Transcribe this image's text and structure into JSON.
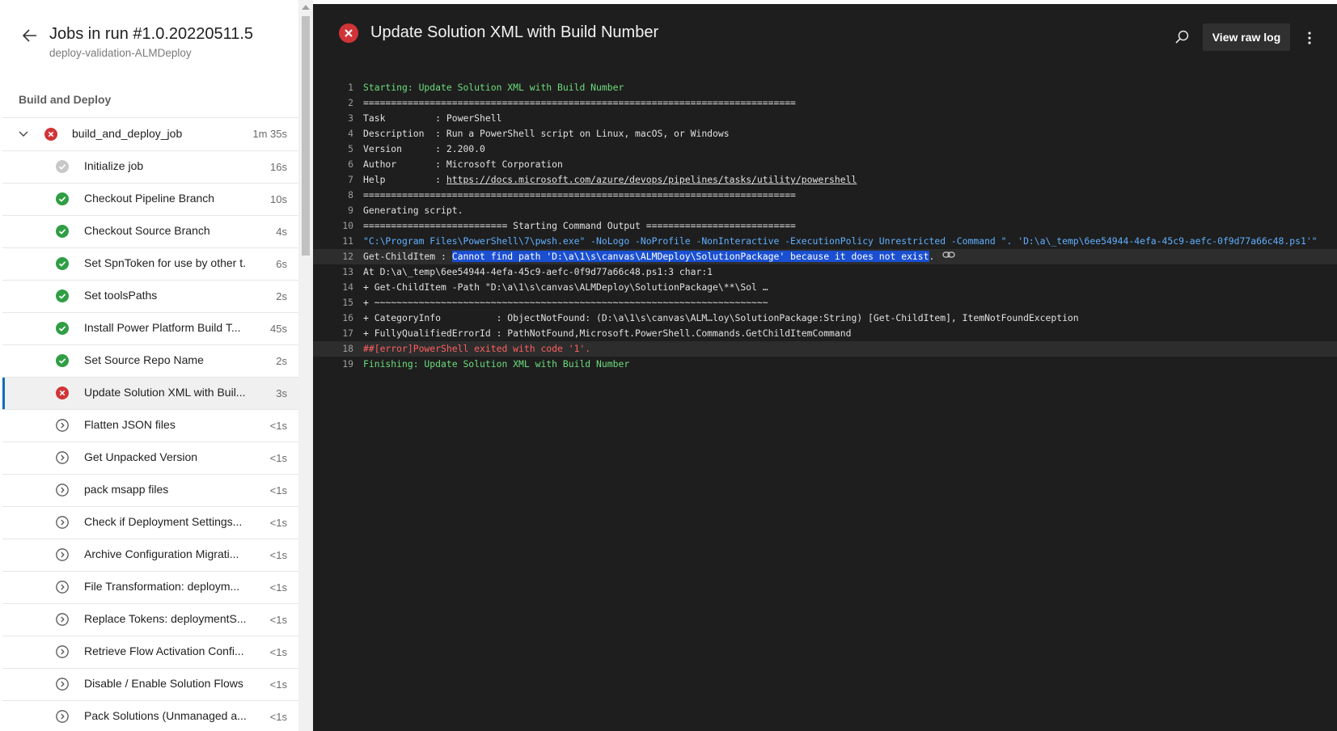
{
  "header": {
    "run_title": "Jobs in run #1.0.20220511.5",
    "run_subtitle": "deploy-validation-ALMDeploy",
    "stage_title": "Build and Deploy"
  },
  "job": {
    "name": "build_and_deploy_job",
    "duration": "1m 35s",
    "status": "failed"
  },
  "steps": [
    {
      "name": "Initialize job",
      "duration": "16s",
      "status": "skipped"
    },
    {
      "name": "Checkout Pipeline Branch",
      "duration": "10s",
      "status": "succeeded"
    },
    {
      "name": "Checkout Source Branch",
      "duration": "4s",
      "status": "succeeded"
    },
    {
      "name": "Set SpnToken for use by other t...",
      "duration": "6s",
      "status": "succeeded"
    },
    {
      "name": "Set toolsPaths",
      "duration": "2s",
      "status": "succeeded"
    },
    {
      "name": "Install Power Platform Build T...",
      "duration": "45s",
      "status": "succeeded"
    },
    {
      "name": "Set Source Repo Name",
      "duration": "2s",
      "status": "succeeded"
    },
    {
      "name": "Update Solution XML with Buil...",
      "duration": "3s",
      "status": "failed",
      "selected": true
    },
    {
      "name": "Flatten JSON files",
      "duration": "<1s",
      "status": "pending"
    },
    {
      "name": "Get Unpacked Version",
      "duration": "<1s",
      "status": "pending"
    },
    {
      "name": "pack msapp files",
      "duration": "<1s",
      "status": "pending"
    },
    {
      "name": "Check if Deployment Settings...",
      "duration": "<1s",
      "status": "pending"
    },
    {
      "name": "Archive Configuration Migrati...",
      "duration": "<1s",
      "status": "pending"
    },
    {
      "name": "File Transformation: deploym...",
      "duration": "<1s",
      "status": "pending"
    },
    {
      "name": "Replace Tokens: deploymentS...",
      "duration": "<1s",
      "status": "pending"
    },
    {
      "name": "Retrieve Flow Activation Confi...",
      "duration": "<1s",
      "status": "pending"
    },
    {
      "name": "Disable / Enable Solution Flows",
      "duration": "<1s",
      "status": "pending"
    },
    {
      "name": "Pack Solutions (Unmanaged a...",
      "duration": "<1s",
      "status": "pending"
    }
  ],
  "log_panel": {
    "title": "Update Solution XML with Build Number",
    "raw_log_label": "View raw log"
  },
  "log_lines": [
    {
      "n": "1",
      "style": "green",
      "parts": [
        {
          "t": "Starting: Update Solution XML with Build Number"
        }
      ]
    },
    {
      "n": "2",
      "parts": [
        {
          "t": "=============================================================================="
        }
      ]
    },
    {
      "n": "3",
      "parts": [
        {
          "t": "Task         : PowerShell"
        }
      ]
    },
    {
      "n": "4",
      "parts": [
        {
          "t": "Description  : Run a PowerShell script on Linux, macOS, or Windows"
        }
      ]
    },
    {
      "n": "5",
      "parts": [
        {
          "t": "Version      : 2.200.0"
        }
      ]
    },
    {
      "n": "6",
      "parts": [
        {
          "t": "Author       : Microsoft Corporation"
        }
      ]
    },
    {
      "n": "7",
      "parts": [
        {
          "t": "Help         : "
        },
        {
          "t": "https://docs.microsoft.com/azure/devops/pipelines/tasks/utility/powershell",
          "link": true
        }
      ]
    },
    {
      "n": "8",
      "parts": [
        {
          "t": "=============================================================================="
        }
      ]
    },
    {
      "n": "9",
      "parts": [
        {
          "t": "Generating script."
        }
      ]
    },
    {
      "n": "10",
      "parts": [
        {
          "t": "========================== Starting Command Output ==========================="
        }
      ]
    },
    {
      "n": "11",
      "style": "blue",
      "parts": [
        {
          "t": "\"C:\\Program Files\\PowerShell\\7\\pwsh.exe\" -NoLogo -NoProfile -NonInteractive -ExecutionPolicy Unrestricted -Command \". 'D:\\a\\_temp\\6ee54944-4efa-45c9-aefc-0f9d77a66c48.ps1'\""
        }
      ]
    },
    {
      "n": "12",
      "highlight": true,
      "copy": true,
      "parts": [
        {
          "t": "Get-ChildItem : "
        },
        {
          "t": "Cannot find path 'D:\\a\\1\\s\\canvas\\ALMDeploy\\SolutionPackage' because it does not exist",
          "sel": true
        },
        {
          "t": "."
        }
      ]
    },
    {
      "n": "13",
      "parts": [
        {
          "t": "At D:\\a\\_temp\\6ee54944-4efa-45c9-aefc-0f9d77a66c48.ps1:3 char:1"
        }
      ]
    },
    {
      "n": "14",
      "parts": [
        {
          "t": "+ Get-ChildItem -Path \"D:\\a\\1\\s\\canvas\\ALMDeploy\\SolutionPackage\\**\\Sol …"
        }
      ]
    },
    {
      "n": "15",
      "parts": [
        {
          "t": "+ ~~~~~~~~~~~~~~~~~~~~~~~~~~~~~~~~~~~~~~~~~~~~~~~~~~~~~~~~~~~~~~~~~~~~~~~"
        }
      ]
    },
    {
      "n": "16",
      "parts": [
        {
          "t": "+ CategoryInfo          : ObjectNotFound: (D:\\a\\1\\s\\canvas\\ALM…loy\\SolutionPackage:String) [Get-ChildItem], ItemNotFoundException"
        }
      ]
    },
    {
      "n": "17",
      "parts": [
        {
          "t": "+ FullyQualifiedErrorId : PathNotFound,Microsoft.PowerShell.Commands.GetChildItemCommand"
        }
      ]
    },
    {
      "n": "18",
      "style": "red",
      "highlight": true,
      "parts": [
        {
          "t": "##[error]PowerShell exited with code '1'."
        }
      ]
    },
    {
      "n": "19",
      "style": "green",
      "parts": [
        {
          "t": "Finishing: Update Solution XML with Build Number"
        }
      ]
    }
  ],
  "icons": {
    "back": "arrow-left-icon",
    "chevron": "chevron-down-icon",
    "failed": "error-circle-icon",
    "succeeded": "check-circle-icon",
    "skipped": "check-circle-gray-icon",
    "pending": "chevron-circle-icon",
    "search": "search-icon",
    "more": "more-vertical-icon",
    "copy": "link-copy-icon"
  },
  "colors": {
    "failed": "#d13438",
    "succeeded": "#2f9e44",
    "skipped": "#c8c8c8",
    "pending": "#555555",
    "selection_accent": "#0f6cbd",
    "log_background": "#1e1e1e"
  }
}
